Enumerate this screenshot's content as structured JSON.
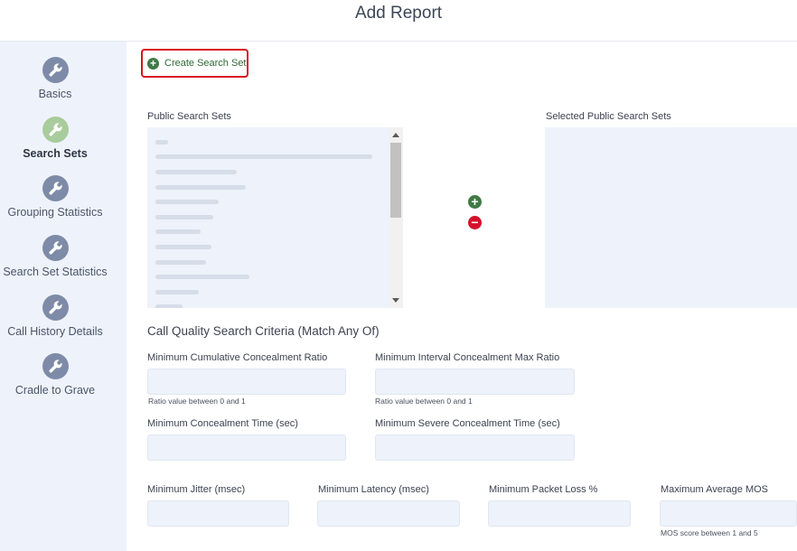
{
  "page_title": "Add Report",
  "sidebar": {
    "steps": [
      {
        "label": "Basics",
        "icon": "wrench-icon",
        "active": false
      },
      {
        "label": "Search Sets",
        "icon": "wrench-icon",
        "active": true
      },
      {
        "label": "Grouping Statistics",
        "icon": "wrench-icon",
        "active": false
      },
      {
        "label": "Search Set Statistics",
        "icon": "wrench-icon",
        "active": false
      },
      {
        "label": "Call History Details",
        "icon": "wrench-icon",
        "active": false
      },
      {
        "label": "Cradle to Grave",
        "icon": "wrench-icon",
        "active": false
      }
    ]
  },
  "toolbar": {
    "create_label": "Create Search Set",
    "create_icon": "plus-circle-icon"
  },
  "public_sets": {
    "label": "Public Search Sets"
  },
  "selected_sets": {
    "label": "Selected Public Search Sets"
  },
  "transfer": {
    "add_icon": "plus-circle-icon",
    "remove_icon": "minus-circle-icon"
  },
  "criteria": {
    "title": "Call Quality Search Criteria (Match Any Of)",
    "fields": {
      "min_cumulative_concealment_ratio": {
        "label": "Minimum Cumulative Concealment Ratio",
        "value": "",
        "hint": "Ratio value between 0 and 1"
      },
      "min_interval_concealment_max_ratio": {
        "label": "Minimum Interval Concealment Max Ratio",
        "value": "",
        "hint": "Ratio value between 0 and 1"
      },
      "min_concealment_time": {
        "label": "Minimum Concealment Time (sec)",
        "value": ""
      },
      "min_severe_concealment_time": {
        "label": "Minimum Severe Concealment Time (sec)",
        "value": ""
      },
      "min_jitter": {
        "label": "Minimum Jitter (msec)",
        "value": ""
      },
      "min_latency": {
        "label": "Minimum Latency (msec)",
        "value": ""
      },
      "min_packet_loss": {
        "label": "Minimum Packet Loss %",
        "value": ""
      },
      "max_average_mos": {
        "label": "Maximum Average MOS",
        "value": "",
        "hint": "MOS score between 1 and 5"
      }
    }
  },
  "colors": {
    "accent_green": "#3f7a45",
    "danger_red": "#d7102b",
    "sidebar_bg": "#eef3fb",
    "field_bg": "#edf2fb"
  }
}
